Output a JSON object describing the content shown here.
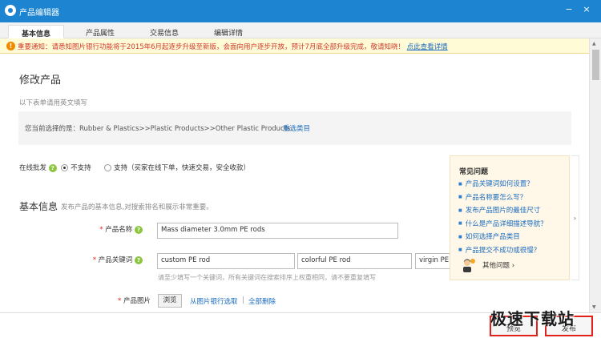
{
  "window": {
    "title": "产品编辑器",
    "min_icon": "minimize-icon",
    "close_icon": "close-icon"
  },
  "tabs": [
    {
      "label": "基本信息",
      "active": true
    },
    {
      "label": "产品属性",
      "active": false
    },
    {
      "label": "交易信息",
      "active": false
    },
    {
      "label": "编辑详情",
      "active": false
    }
  ],
  "notice": {
    "text": "重要通知：请悉知图片银行功能将于2015年6月起逐步升级至新版，会面向用户逐步开放，预计7月底全部升级完成，敬请知晓！",
    "link": "点此查看详情"
  },
  "page": {
    "title": "修改产品",
    "hint": "以下表单请用英文填写",
    "category_label": "您当前选择的是：Rubber & Plastics>>Plastic Products>>Other Plastic Products",
    "reselect": "重选类目"
  },
  "wholesale": {
    "label": "在线批发",
    "option_no": "不支持",
    "option_yes": "支持（买家在线下单，快速交易，安全收款）",
    "selected": "不支持"
  },
  "basic_info": {
    "title": "基本信息",
    "desc": "发布产品的基本信息,对搜索排名和展示非常重要。",
    "product_name_label": "产品名称",
    "product_name_value": "Mass diameter 3.0mm PE rods",
    "keywords_label": "产品关键词",
    "keywords": [
      "custom PE rod",
      "colorful PE rod",
      "virgin PE rod"
    ],
    "keywords_hint": "请至少填写一个关键词，所有关键词在搜索排序上权重相同，请不要重复填写",
    "image_label": "产品图片",
    "browse": "浏览",
    "from_bank": "从图片银行选取",
    "separator": "|",
    "delete_all": "全部删除"
  },
  "faq": {
    "title": "常见问题",
    "items": [
      "产品关键词如何设置？",
      "产品名称要怎么写？",
      "发布产品图片的最佳尺寸",
      "什么是产品详细描述导航？",
      "如何选择产品类目",
      "产品提交不成功或很慢？"
    ],
    "more": "其他问题",
    "more_arrow": "›",
    "collapse_arrow": "›"
  },
  "footer": {
    "preview": "预览",
    "publish": "发布"
  },
  "watermark": "极速下载站",
  "colors": {
    "titlebar": "#1c84d1",
    "link": "#1a6bbf",
    "required": "#e2231a",
    "notice_text": "#d03a2e",
    "highlight": "#e3211b"
  }
}
